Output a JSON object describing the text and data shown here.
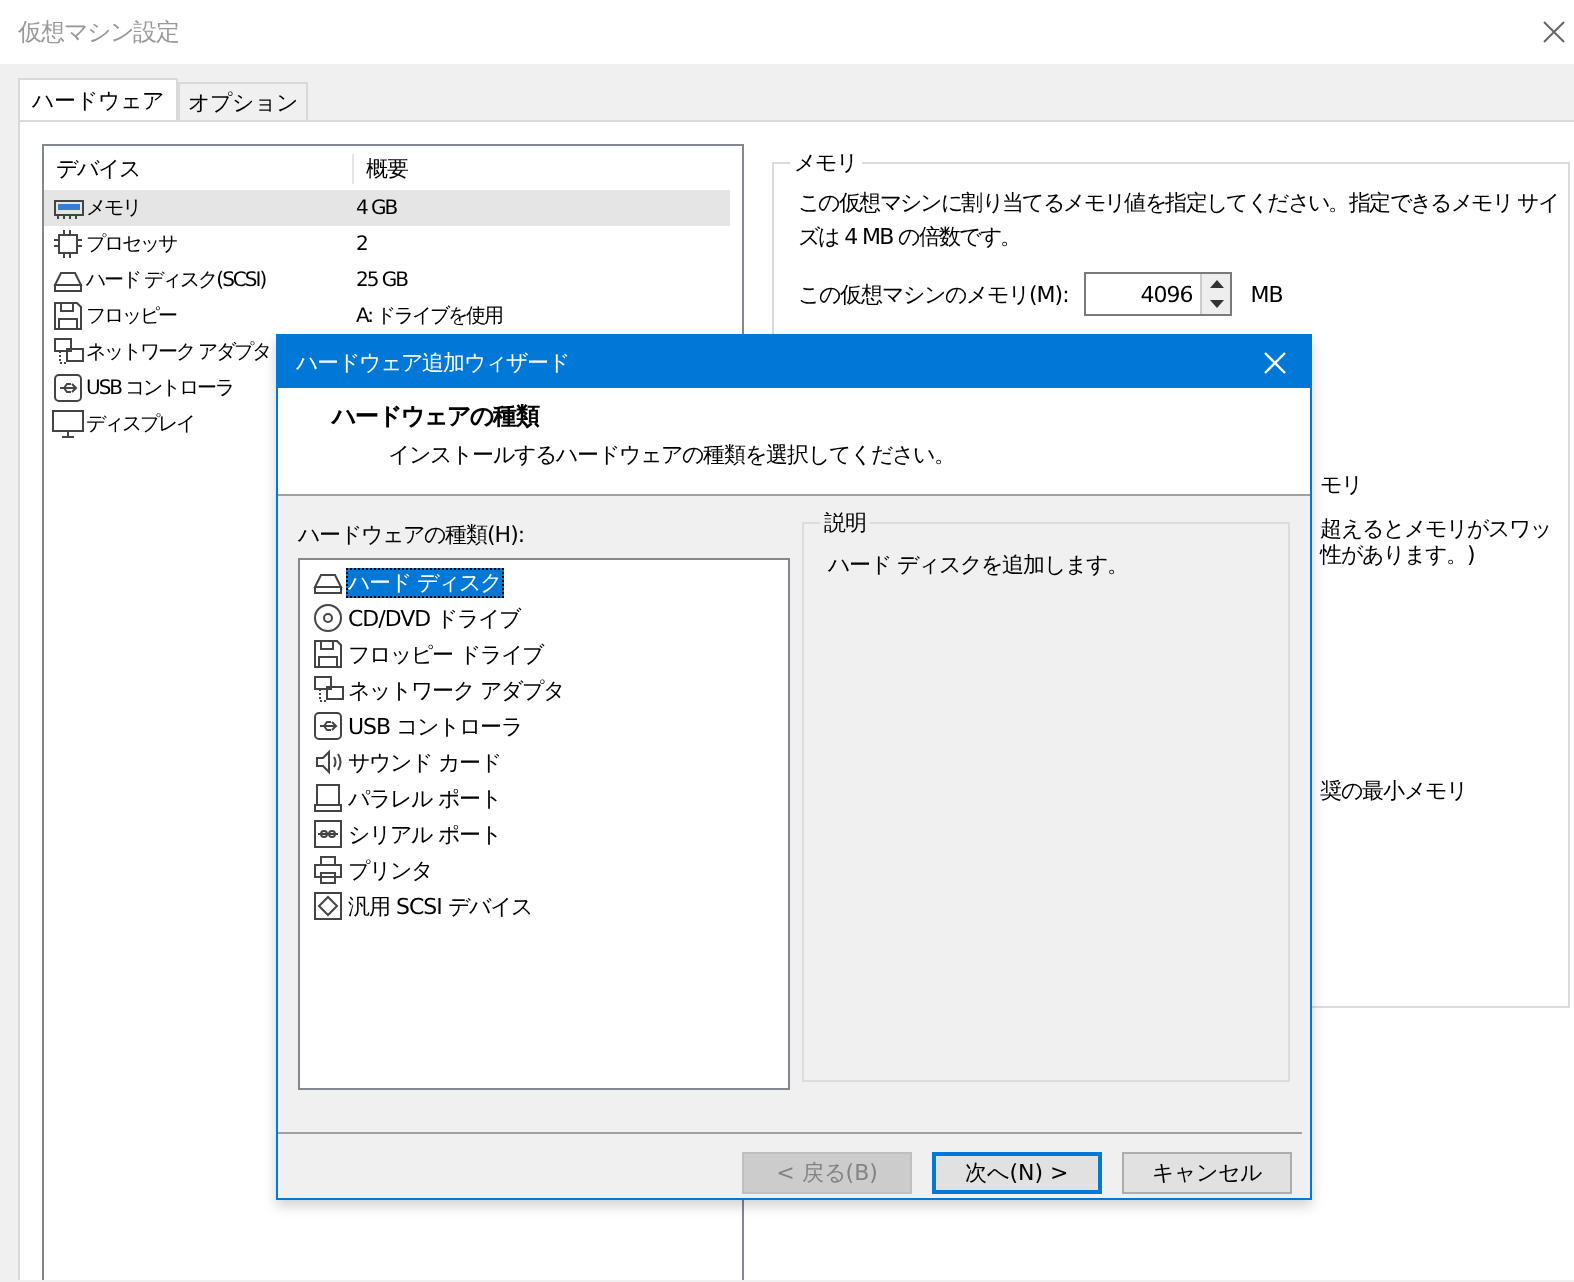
{
  "window": {
    "title": "仮想マシン設定"
  },
  "tabs": [
    {
      "label": "ハードウェア",
      "selected": true
    },
    {
      "label": "オプション",
      "selected": false
    }
  ],
  "device_table": {
    "columns": [
      "デバイス",
      "概要"
    ],
    "rows": [
      {
        "kind": "memory",
        "device": "メモリ",
        "summary": "4 GB",
        "selected": true
      },
      {
        "kind": "processor",
        "device": "プロセッサ",
        "summary": "2",
        "selected": false
      },
      {
        "kind": "hdd",
        "device": "ハード ディスク(SCSI)",
        "summary": "25 GB",
        "selected": false
      },
      {
        "kind": "floppy",
        "device": "フロッピー",
        "summary": "A: ドライブを使用",
        "selected": false
      },
      {
        "kind": "network",
        "device": "ネットワーク アダプタ",
        "selected": false
      },
      {
        "kind": "usb",
        "device": "USB コントローラ",
        "selected": false
      },
      {
        "kind": "display",
        "device": "ディスプレイ",
        "selected": false
      }
    ]
  },
  "memory_group": {
    "legend": "メモリ",
    "description": "この仮想マシンに割り当てるメモリ値を指定してください。指定できるメモリ サイズは 4 MB の倍数です。",
    "memory_label": "この仮想マシンのメモリ(M):",
    "memory_value": "4096",
    "unit": "MB",
    "obscured_lines": [
      "モリ",
      "超えるとメモリがスワッ",
      "性があります。)",
      "奨の最小メモリ"
    ]
  },
  "wizard": {
    "title": "ハードウェア追加ウィザード",
    "heading": "ハードウェアの種類",
    "subtitle": "インストールするハードウェアの種類を選択してください。",
    "list_label": "ハードウェアの種類(H):",
    "hardware_types": [
      {
        "kind": "hdd",
        "label": "ハード ディスク",
        "selected": true
      },
      {
        "kind": "cdrom",
        "label": "CD/DVD ドライブ",
        "selected": false
      },
      {
        "kind": "floppy",
        "label": "フロッピー ドライブ",
        "selected": false
      },
      {
        "kind": "network",
        "label": "ネットワーク アダプタ",
        "selected": false
      },
      {
        "kind": "usb",
        "label": "USB コントローラ",
        "selected": false
      },
      {
        "kind": "sound",
        "label": "サウンド カード",
        "selected": false
      },
      {
        "kind": "parallel",
        "label": "パラレル ポート",
        "selected": false
      },
      {
        "kind": "serial",
        "label": "シリアル ポート",
        "selected": false
      },
      {
        "kind": "printer",
        "label": "プリンタ",
        "selected": false
      },
      {
        "kind": "scsi",
        "label": "汎用 SCSI デバイス",
        "selected": false
      }
    ],
    "description_legend": "説明",
    "description": "ハード ディスクを追加します。",
    "buttons": [
      {
        "label": "< 戻る(B)",
        "disabled": true,
        "focused": false
      },
      {
        "label": "次へ(N) >",
        "disabled": false,
        "focused": true
      },
      {
        "label": "キャンセル",
        "disabled": false,
        "focused": false
      }
    ]
  }
}
